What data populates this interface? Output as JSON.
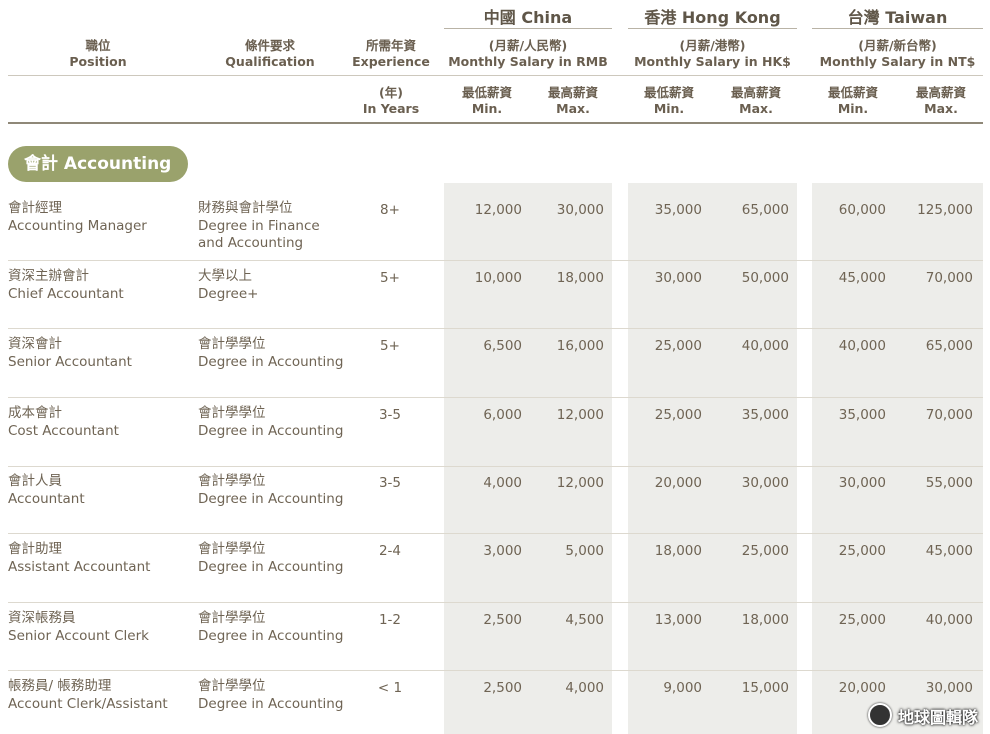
{
  "header": {
    "position": [
      "職位",
      "Position"
    ],
    "qualification": [
      "條件要求",
      "Qualification"
    ],
    "experience": [
      "所需年資",
      "Experience"
    ],
    "years": [
      "(年)",
      "In Years"
    ],
    "regions": [
      {
        "name": "中國 China",
        "salary": [
          "(月薪/人民幣)",
          "Monthly Salary in RMB"
        ]
      },
      {
        "name": "香港 Hong Kong",
        "salary": [
          "(月薪/港幣)",
          "Monthly Salary in HK$"
        ]
      },
      {
        "name": "台灣 Taiwan",
        "salary": [
          "(月薪/新台幣)",
          "Monthly Salary in NT$"
        ]
      }
    ],
    "min": [
      "最低薪資",
      "Min."
    ],
    "max": [
      "最高薪資",
      "Max."
    ]
  },
  "section": "會計 Accounting",
  "rows": [
    {
      "pos_zh": "會計經理",
      "pos_en": "Accounting Manager",
      "qual_zh": "財務與會計學位",
      "qual_en": "Degree in Finance and Accounting",
      "exp": "8+",
      "cn_min": "12,000",
      "cn_max": "30,000",
      "hk_min": "35,000",
      "hk_max": "65,000",
      "tw_min": "60,000",
      "tw_max": "125,000"
    },
    {
      "pos_zh": "資深主辦會計",
      "pos_en": "Chief Accountant",
      "qual_zh": "大學以上",
      "qual_en": "Degree+",
      "exp": "5+",
      "cn_min": "10,000",
      "cn_max": "18,000",
      "hk_min": "30,000",
      "hk_max": "50,000",
      "tw_min": "45,000",
      "tw_max": "70,000"
    },
    {
      "pos_zh": "資深會計",
      "pos_en": "Senior Accountant",
      "qual_zh": "會計學學位",
      "qual_en": "Degree in  Accounting",
      "exp": "5+",
      "cn_min": "6,500",
      "cn_max": "16,000",
      "hk_min": "25,000",
      "hk_max": "40,000",
      "tw_min": "40,000",
      "tw_max": "65,000"
    },
    {
      "pos_zh": "成本會計",
      "pos_en": "Cost Accountant",
      "qual_zh": "會計學學位",
      "qual_en": "Degree in  Accounting",
      "exp": "3-5",
      "cn_min": "6,000",
      "cn_max": "12,000",
      "hk_min": "25,000",
      "hk_max": "35,000",
      "tw_min": "35,000",
      "tw_max": "70,000"
    },
    {
      "pos_zh": "會計人員",
      "pos_en": "Accountant",
      "qual_zh": "會計學學位",
      "qual_en": "Degree in  Accounting",
      "exp": "3-5",
      "cn_min": "4,000",
      "cn_max": "12,000",
      "hk_min": "20,000",
      "hk_max": "30,000",
      "tw_min": "30,000",
      "tw_max": "55,000"
    },
    {
      "pos_zh": "會計助理",
      "pos_en": "Assistant Accountant",
      "qual_zh": "會計學學位",
      "qual_en": "Degree in  Accounting",
      "exp": "2-4",
      "cn_min": "3,000",
      "cn_max": "5,000",
      "hk_min": "18,000",
      "hk_max": "25,000",
      "tw_min": "25,000",
      "tw_max": "45,000"
    },
    {
      "pos_zh": "資深帳務員",
      "pos_en": "Senior Account Clerk",
      "qual_zh": "會計學學位",
      "qual_en": "Degree in  Accounting",
      "exp": "1-2",
      "cn_min": "2,500",
      "cn_max": "4,500",
      "hk_min": "13,000",
      "hk_max": "18,000",
      "tw_min": "25,000",
      "tw_max": "40,000"
    },
    {
      "pos_zh": "帳務員/ 帳務助理",
      "pos_en": "Account Clerk/Assistant",
      "qual_zh": "會計學學位",
      "qual_en": "Degree in  Accounting",
      "exp": "< 1",
      "cn_min": "2,500",
      "cn_max": "4,000",
      "hk_min": "9,000",
      "hk_max": "15,000",
      "tw_min": "20,000",
      "tw_max": "30,000"
    }
  ],
  "watermark": "地球圖輯隊"
}
